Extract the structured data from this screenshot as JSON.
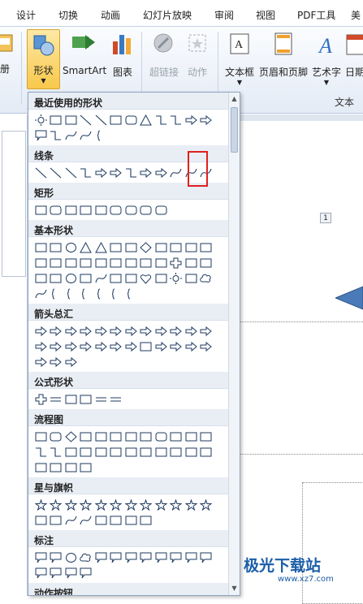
{
  "tabs": [
    "设计",
    "切换",
    "动画",
    "幻灯片放映",
    "审阅",
    "视图",
    "PDF工具",
    "美"
  ],
  "ribbon": {
    "cut_label": "册",
    "shapes": "形状",
    "smartart": "SmartArt",
    "chart": "图表",
    "hyperlink": "超链接",
    "action": "动作",
    "textbox": "文本框",
    "header_footer": "页眉和页脚",
    "wordart": "艺术字",
    "datetime": "日期",
    "group_text": "文本"
  },
  "dropdown": {
    "sections": [
      {
        "title": "最近使用的形状",
        "icons": [
          "gear-icon",
          "text-box-icon",
          "picture-box-icon",
          "line-icon",
          "arrow-line-icon",
          "rectangle-icon",
          "rounded-rectangle-icon",
          "triangle-icon",
          "elbow-connector-icon",
          "elbow-connector-icon",
          "right-arrow-icon",
          "down-arrow-icon",
          "rounded-callout-icon",
          "curved-connector-icon",
          "arc-icon",
          "curve-icon",
          "brace-icon"
        ]
      },
      {
        "title": "线条",
        "icons": [
          "line-icon",
          "arrow-line-icon",
          "double-arrow-line-icon",
          "elbow-connector-icon",
          "elbow-arrow-icon",
          "elbow-double-arrow-icon",
          "curved-connector-icon",
          "curved-arrow-icon",
          "curved-double-arrow-icon",
          "curve-icon",
          "freeform-icon",
          "scribble-icon"
        ]
      },
      {
        "title": "矩形",
        "icons": [
          "rectangle-icon",
          "rounded-rectangle-icon",
          "snip-corner-rectangle-icon",
          "snip-corners-rectangle-icon",
          "snip-diagonal-rectangle-icon",
          "snip-round-rectangle-icon",
          "round-corner-rectangle-icon",
          "round-corners-rectangle-icon",
          "round-diagonal-rectangle-icon"
        ]
      },
      {
        "title": "基本形状",
        "icons": [
          "text-box-icon",
          "picture-box-icon",
          "oval-icon",
          "triangle-icon",
          "right-triangle-icon",
          "parallelogram-icon",
          "trapezoid-icon",
          "diamond-icon",
          "pentagon-icon",
          "hexagon-icon",
          "heptagon-icon",
          "octagon-icon",
          "decagon-icon",
          "dodecagon-icon",
          "pie-icon",
          "chord-icon",
          "teardrop-icon",
          "frame-icon",
          "half-frame-icon",
          "l-shape-icon",
          "diagonal-stripe-icon",
          "cross-icon",
          "plaque-icon",
          "can-icon",
          "cube-icon",
          "bevel-icon",
          "donut-icon",
          "no-symbol-icon",
          "block-arc-icon",
          "folded-corner-icon",
          "smiley-icon",
          "heart-icon",
          "lightning-icon",
          "sun-icon",
          "moon-icon",
          "cloud-icon",
          "arc-icon",
          "double-bracket-icon",
          "double-brace-icon",
          "left-bracket-icon",
          "right-bracket-icon",
          "left-brace-icon",
          "right-brace-icon"
        ]
      },
      {
        "title": "箭头总汇",
        "icons": [
          "right-arrow-icon",
          "left-arrow-icon",
          "up-arrow-icon",
          "down-arrow-icon",
          "left-right-arrow-icon",
          "up-down-arrow-icon",
          "quad-arrow-icon",
          "left-right-up-arrow-icon",
          "bent-arrow-icon",
          "u-turn-arrow-icon",
          "left-up-arrow-icon",
          "bent-up-arrow-icon",
          "curved-right-arrow-icon",
          "curved-left-arrow-icon",
          "curved-up-arrow-icon",
          "curved-down-arrow-icon",
          "striped-right-arrow-icon",
          "notched-right-arrow-icon",
          "pentagon-arrow-icon",
          "chevron-icon",
          "right-arrow-callout-icon",
          "down-arrow-callout-icon",
          "left-arrow-callout-icon",
          "up-arrow-callout-icon",
          "left-right-arrow-callout-icon",
          "quad-arrow-callout-icon",
          "circular-arrow-icon"
        ]
      },
      {
        "title": "公式形状",
        "icons": [
          "plus-icon",
          "minus-icon",
          "multiply-icon",
          "divide-icon",
          "equal-icon",
          "not-equal-icon"
        ]
      },
      {
        "title": "流程图",
        "icons": [
          "process-icon",
          "alternate-process-icon",
          "decision-icon",
          "data-icon",
          "predefined-process-icon",
          "internal-storage-icon",
          "document-icon",
          "multidocument-icon",
          "terminator-icon",
          "preparation-icon",
          "manual-input-icon",
          "manual-operation-icon",
          "connector-icon",
          "off-page-connector-icon",
          "card-icon",
          "punched-tape-icon",
          "summing-junction-icon",
          "or-icon",
          "collate-icon",
          "sort-icon",
          "extract-icon",
          "merge-icon",
          "stored-data-icon",
          "delay-icon",
          "sequential-storage-icon",
          "magnetic-disk-icon",
          "direct-access-storage-icon",
          "display-icon"
        ]
      },
      {
        "title": "星与旗帜",
        "icons": [
          "explosion-1-icon",
          "explosion-2-icon",
          "star-4-icon",
          "star-5-icon",
          "star-6-icon",
          "star-7-icon",
          "star-8-icon",
          "star-10-icon",
          "star-12-icon",
          "star-16-icon",
          "star-24-icon",
          "star-32-icon",
          "ribbon-up-icon",
          "ribbon-down-icon",
          "curved-ribbon-up-icon",
          "curved-ribbon-down-icon",
          "vertical-scroll-icon",
          "horizontal-scroll-icon",
          "wave-icon",
          "double-wave-icon"
        ]
      },
      {
        "title": "标注",
        "icons": [
          "rectangular-callout-icon",
          "rounded-rectangular-callout-icon",
          "oval-callout-icon",
          "cloud-callout-icon",
          "line-callout-1-icon",
          "line-callout-2-icon",
          "line-callout-3-icon",
          "line-callout-4-icon",
          "line-callout-1-accent-icon",
          "line-callout-2-accent-icon",
          "line-callout-3-accent-icon",
          "line-callout-4-accent-icon",
          "line-callout-1-border-icon",
          "line-callout-2-border-icon",
          "line-callout-3-border-icon",
          "line-callout-4-border-icon"
        ]
      },
      {
        "title": "动作按钮",
        "icons": [
          "action-back-icon",
          "action-forward-icon",
          "action-beginning-icon",
          "action-end-icon",
          "action-home-icon",
          "action-information-icon",
          "action-return-icon",
          "action-movie-icon",
          "action-document-icon",
          "action-sound-icon",
          "action-help-icon",
          "action-custom-icon"
        ]
      }
    ]
  },
  "slide": {
    "page_badge": "1"
  },
  "watermark": {
    "brand": "极光下载站",
    "url": "www.xz7.com"
  }
}
